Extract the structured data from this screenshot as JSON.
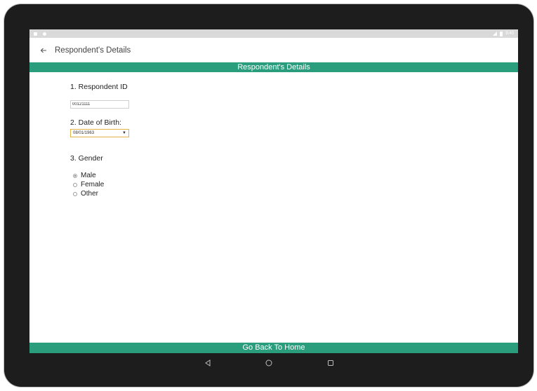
{
  "app": {
    "title": "Respondent's Details",
    "header_band": "Respondent's Details",
    "status_time": "9:40"
  },
  "form": {
    "q1": {
      "label": "1. Respondent ID",
      "value": "00121111"
    },
    "q2": {
      "label": "2. Date of Birth:",
      "value": "08/01/1963"
    },
    "q3": {
      "label": "3. Gender",
      "options": [
        "Male",
        "Female",
        "Other"
      ],
      "selected": "Male"
    }
  },
  "footer": {
    "button_label": "Go Back To Home"
  },
  "colors": {
    "accent": "#2a9d7d",
    "select_border": "#e3b348"
  },
  "icons": {
    "back": "arrow-left-icon",
    "nav_back": "triangle-back-icon",
    "nav_home": "circle-home-icon",
    "nav_recent": "square-recent-icon"
  }
}
